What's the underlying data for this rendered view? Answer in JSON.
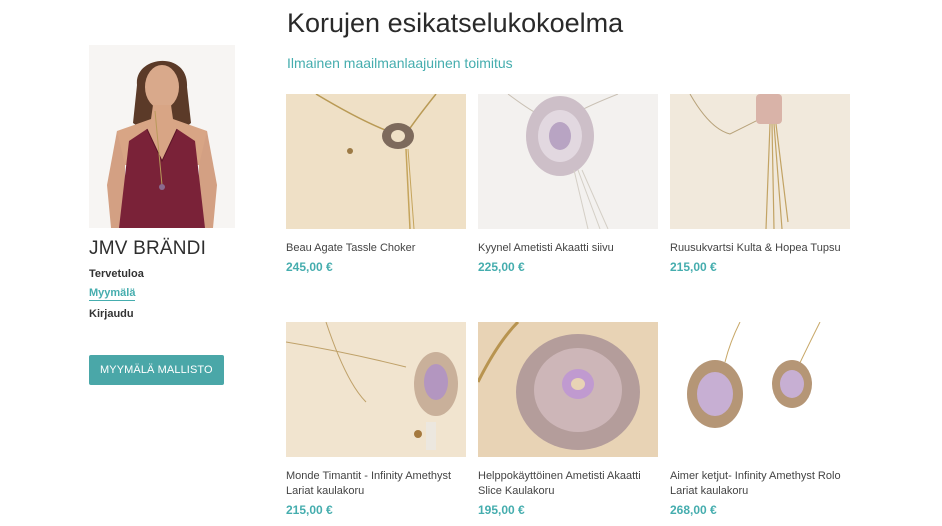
{
  "page": {
    "title": "Korujen esikatselukokoelma",
    "subtitle": "Ilmainen maailmanlaajuinen toimitus"
  },
  "sidebar": {
    "brand": "JMV BRÄNDI",
    "nav": [
      {
        "label": "Tervetuloa"
      },
      {
        "label": "Myymälä"
      },
      {
        "label": "Kirjaudu"
      }
    ],
    "collection_button": "MYYMÄLÄ MALLISTO"
  },
  "products": [
    {
      "name": "Beau Agate Tassle Choker",
      "price": "245,00 €"
    },
    {
      "name": "Kyynel Ametisti Akaatti siivu",
      "price": "225,00 €"
    },
    {
      "name": "Ruusukvartsi Kulta & Hopea Tupsu",
      "price": "215,00 €"
    },
    {
      "name": "Monde Timantit - Infinity Amethyst Lariat kaulakoru",
      "price": "215,00 €"
    },
    {
      "name": "Helppokäyttöinen Ametisti Akaatti Slice Kaulakoru",
      "price": "195,00 €"
    },
    {
      "name": "Aimer ketjut- Infinity Amethyst Rolo Lariat kaulakoru",
      "price": "268,00 €"
    }
  ],
  "colors": {
    "accent": "#45adae",
    "button": "#4aa7a8"
  }
}
